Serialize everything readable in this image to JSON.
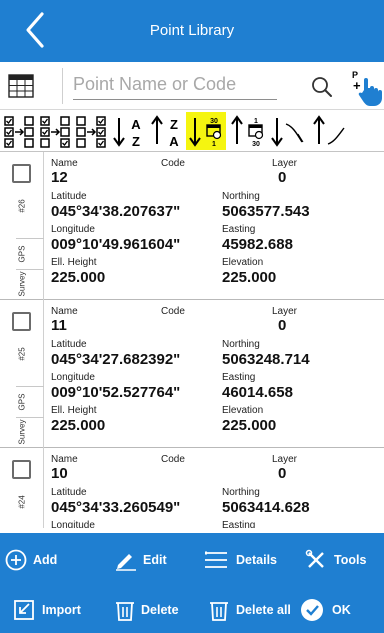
{
  "header": {
    "title": "Point Library"
  },
  "search": {
    "placeholder": "Point Name or Code"
  },
  "colors": {
    "primary": "#1f7fd1",
    "active_sort": "#f5f510"
  },
  "sort_buttons": [
    {
      "name": "select-all",
      "icon": "select-all-icon"
    },
    {
      "name": "invert-selection",
      "icon": "invert-selection-icon"
    },
    {
      "name": "select-none",
      "icon": "deselect-icon"
    },
    {
      "name": "sort-a-z",
      "icon": "sort-az-icon",
      "text": [
        "A",
        "Z"
      ]
    },
    {
      "name": "sort-z-a",
      "icon": "sort-za-icon",
      "text": [
        "Z",
        "A"
      ]
    },
    {
      "name": "sort-date-desc",
      "icon": "sort-date-desc-icon",
      "text": [
        "30",
        "1"
      ],
      "active": true
    },
    {
      "name": "sort-date-asc",
      "icon": "sort-date-asc-icon",
      "text": [
        "1",
        "30"
      ]
    },
    {
      "name": "sort-elevation-desc",
      "icon": "sort-elevation-icon"
    },
    {
      "name": "sort-elevation-asc",
      "icon": "sort-elevation-asc-icon"
    }
  ],
  "field_labels": {
    "name": "Name",
    "code": "Code",
    "layer": "Layer",
    "latitude": "Latitude",
    "northing": "Northing",
    "longitude": "Longitude",
    "easting": "Easting",
    "ell_height": "Ell. Height",
    "elevation": "Elevation"
  },
  "side_labels": {
    "gps": "GPS",
    "survey": "Survey"
  },
  "points": [
    {
      "index": "#26",
      "name": "12",
      "code": "",
      "layer": "0",
      "latitude": "045°34'38.207637\"",
      "northing": "5063577.543",
      "longitude": "009°10'49.961604\"",
      "easting": "45982.688",
      "ell_height": "225.000",
      "elevation": "225.000"
    },
    {
      "index": "#25",
      "name": "11",
      "code": "",
      "layer": "0",
      "latitude": "045°34'27.682392\"",
      "northing": "5063248.714",
      "longitude": "009°10'52.527764\"",
      "easting": "46014.658",
      "ell_height": "225.000",
      "elevation": "225.000"
    },
    {
      "index": "#24",
      "name": "10",
      "code": "",
      "layer": "0",
      "latitude": "045°34'33.260549\"",
      "northing": "5063414.628",
      "longitude": "Longitude",
      "easting": "Easting",
      "ell_height": "",
      "elevation": ""
    }
  ],
  "bottom_actions": {
    "add": "Add",
    "edit": "Edit",
    "details": "Details",
    "tools": "Tools",
    "import": "Import",
    "delete": "Delete",
    "delete_all": "Delete all",
    "ok": "OK"
  }
}
